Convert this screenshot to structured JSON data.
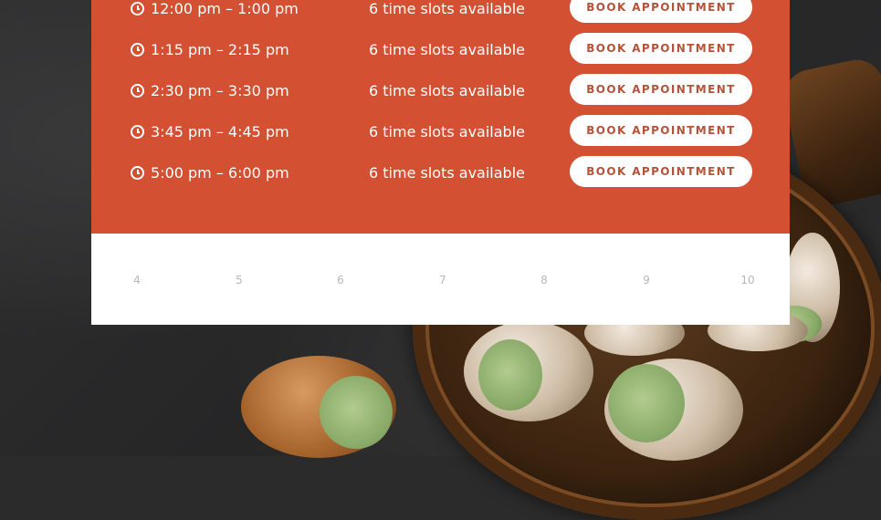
{
  "time_slots": [
    {
      "time": "12:00 pm – 1:00 pm",
      "availability": "6 time slots available",
      "button_label": "BOOK APPOINTMENT"
    },
    {
      "time": "1:15 pm – 2:15 pm",
      "availability": "6 time slots available",
      "button_label": "BOOK APPOINTMENT"
    },
    {
      "time": "2:30 pm – 3:30 pm",
      "availability": "6 time slots available",
      "button_label": "BOOK APPOINTMENT"
    },
    {
      "time": "3:45 pm – 4:45 pm",
      "availability": "6 time slots available",
      "button_label": "BOOK APPOINTMENT"
    },
    {
      "time": "5:00 pm – 6:00 pm",
      "availability": "6 time slots available",
      "button_label": "BOOK APPOINTMENT"
    }
  ],
  "calendar_days": [
    "4",
    "5",
    "6",
    "7",
    "8",
    "9",
    "10"
  ],
  "colors": {
    "panel": "#d35033",
    "button_text": "#b4533a",
    "day_number": "#b7b7b7"
  },
  "icons": {
    "slot_icon": "clock-icon"
  }
}
